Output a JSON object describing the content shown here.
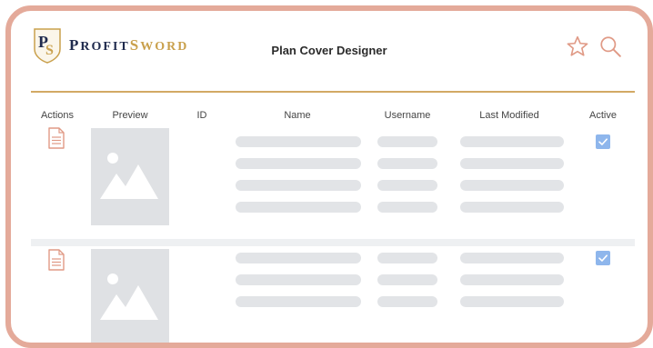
{
  "header": {
    "brand_prefix": "P",
    "brand_suffix": "ROFIT",
    "brand_prefix2": "S",
    "brand_suffix2": "WORD",
    "title": "Plan Cover Designer",
    "icons": [
      "star-icon",
      "search-icon"
    ]
  },
  "table": {
    "columns": [
      "Actions",
      "Preview",
      "ID",
      "Name",
      "Username",
      "Last Modified",
      "Active"
    ],
    "rows": [
      {
        "action_icon": "document-icon",
        "preview_icon": "image-placeholder-icon",
        "active": true
      },
      {
        "action_icon": "document-icon",
        "preview_icon": "image-placeholder-icon",
        "active": true
      }
    ]
  },
  "colors": {
    "frame": "#e4aa9a",
    "gold": "#d2a964",
    "icon": "#e09a86",
    "navy": "#1f2a4d",
    "placeholder": "#dfe1e4",
    "checkbox": "#8eb6ec"
  }
}
